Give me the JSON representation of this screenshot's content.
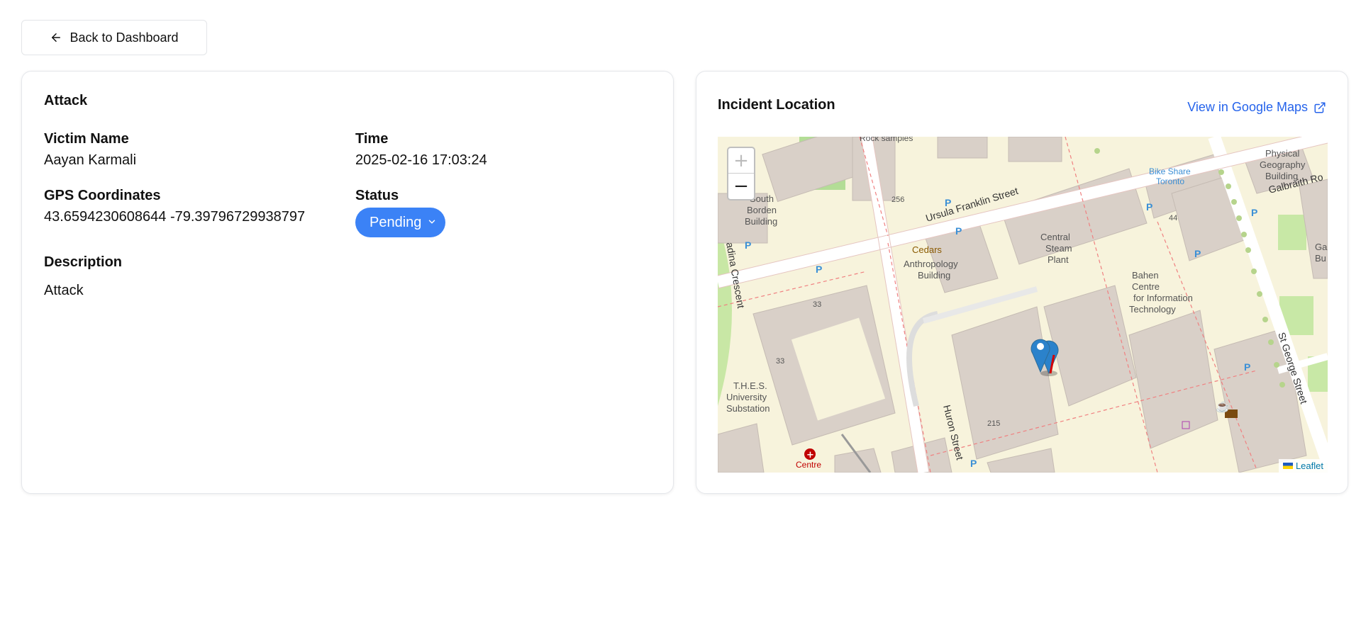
{
  "nav": {
    "back_label": "Back to Dashboard"
  },
  "incident": {
    "title": "Attack",
    "victim_label": "Victim Name",
    "victim_value": "Aayan Karmali",
    "time_label": "Time",
    "time_value": "2025-02-16 17:03:24",
    "gps_label": "GPS Coordinates",
    "gps_value": "43.6594230608644 -79.39796729938797",
    "status_label": "Status",
    "status_value": "Pending",
    "description_label": "Description",
    "description_value": "Attack"
  },
  "location": {
    "title": "Incident Location",
    "gmaps_label": "View in Google Maps",
    "zoom_in": "+",
    "zoom_out": "−",
    "attribution": "Leaflet",
    "labels": {
      "rock": "Rock samples",
      "south_borden_1": "South",
      "south_borden_2": "Borden",
      "south_borden_3": "Building",
      "ursula": "Ursula Franklin Street",
      "bike_share_1": "Bike Share",
      "bike_share_2": "Toronto",
      "physical_1": "Physical",
      "physical_2": "Geography",
      "physical_3": "Building",
      "galbraith": "Galbraith Ro",
      "central_1": "Central",
      "central_2": "Steam",
      "central_3": "Plant",
      "cedars": "Cedars",
      "anthro_1": "Anthropology",
      "anthro_2": "Building",
      "bahen_1": "Bahen",
      "bahen_2": "Centre",
      "bahen_3": "for Information",
      "bahen_4": "Technology",
      "spadina": "adina Crescent",
      "thes_1": "T.H.E.S.",
      "thes_2": "University",
      "thes_3": "Substation",
      "huron": "Huron Street",
      "st_george": "St George Street",
      "centre": "Centre",
      "num_256": "256",
      "num_44": "44",
      "num_33a": "33",
      "num_33b": "33",
      "num_215": "215",
      "ga_1": "Ga",
      "ga_2": "Bu"
    }
  }
}
